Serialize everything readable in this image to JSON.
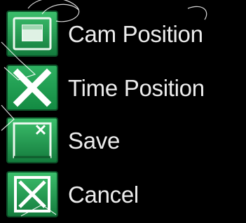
{
  "menu": {
    "items": [
      {
        "label": "Cam Position",
        "icon": "camera-position-icon"
      },
      {
        "label": "Time Position",
        "icon": "x-icon"
      },
      {
        "label": "Save",
        "icon": "save-window-icon"
      },
      {
        "label": "Cancel",
        "icon": "cancel-box-icon"
      }
    ]
  },
  "colors": {
    "background": "#000000",
    "text": "#ececec",
    "icon_green": "#1e8f4a",
    "icon_green_light": "#36b565",
    "icon_green_dark": "#0f5c2d"
  }
}
